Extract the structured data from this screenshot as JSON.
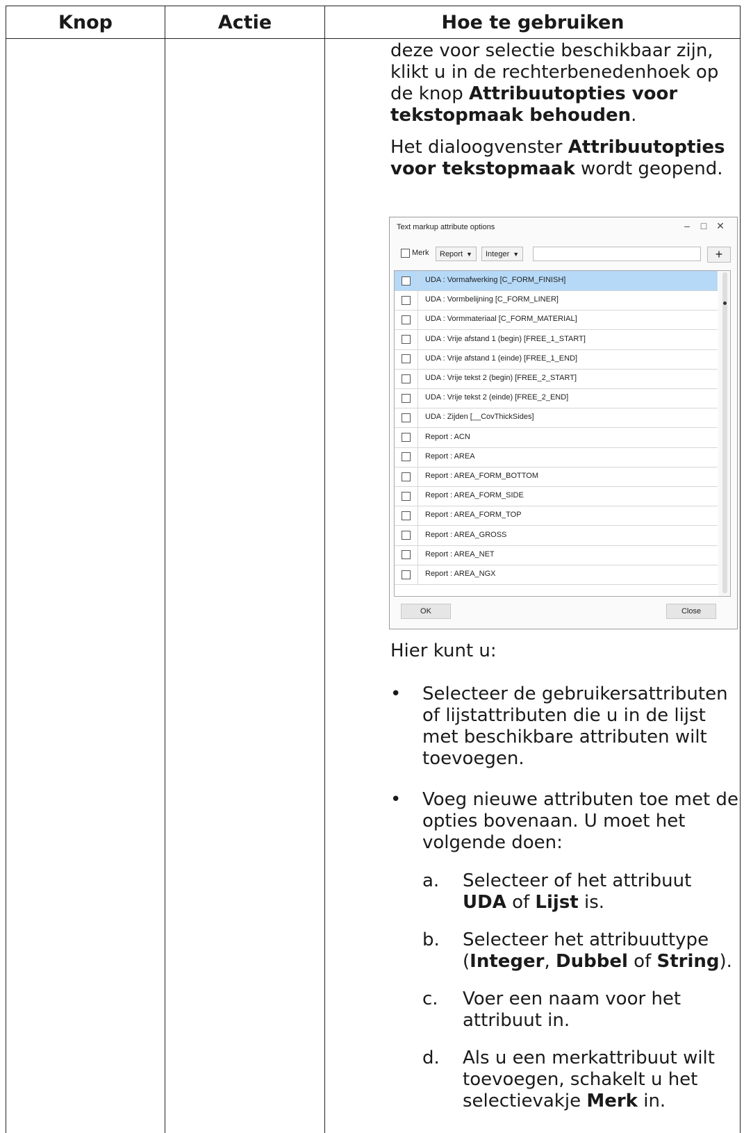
{
  "headers": [
    "Knop",
    "Actie",
    "Hoe te gebruiken"
  ],
  "intro": {
    "p1_a": "deze voor selectie beschikbaar zijn, klikt u in de rechterbenedenhoek op de knop ",
    "p1_bold": "Attribuutopties voor tekstopmaak behouden",
    "p1_end": ".",
    "p2_a": "Het dialoogvenster ",
    "p2_bold": "Attribuutopties voor tekstopmaak",
    "p2_end": " wordt geopend."
  },
  "dialog": {
    "title": "Text markup attribute options",
    "merk_label": "Merk",
    "type_dropdown": "Report",
    "value_dropdown": "Integer",
    "add_symbol": "+",
    "ok_label": "OK",
    "close_label": "Close",
    "rows": [
      "UDA : Vormafwerking [C_FORM_FINISH]",
      "UDA : Vormbelijning [C_FORM_LINER]",
      "UDA : Vormmateriaal [C_FORM_MATERIAL]",
      "UDA : Vrije afstand 1 (begin) [FREE_1_START]",
      "UDA : Vrije afstand 1 (einde) [FREE_1_END]",
      "UDA : Vrije tekst 2 (begin) [FREE_2_START]",
      "UDA : Vrije tekst 2 (einde) [FREE_2_END]",
      "UDA : Zijden [__CovThickSides]",
      "Report : ACN",
      "Report : AREA",
      "Report : AREA_FORM_BOTTOM",
      "Report : AREA_FORM_SIDE",
      "Report : AREA_FORM_TOP",
      "Report : AREA_GROSS",
      "Report : AREA_NET",
      "Report : AREA_NGX"
    ]
  },
  "lower": {
    "lead": "Hier kunt u:",
    "bullet_symbol": "•",
    "bullet1": "Selecteer de gebruikersattributen of lijstattributen die u in de lijst met beschikbare attributen wilt toevoegen.",
    "bullet2": "Voeg nieuwe attributen toe met de opties bovenaan. U moet het volgende doen:",
    "a_label": "a.",
    "a_1": "Selecteer of het attribuut ",
    "a_b1": "UDA",
    "a_2": " of ",
    "a_b2": "Lijst",
    "a_3": " is.",
    "b_label": "b.",
    "b_1": "Selecteer het attribuuttype (",
    "b_b1": "Integer",
    "b_2": ", ",
    "b_b2": "Dubbel",
    "b_3": " of ",
    "b_b3": "String",
    "b_4": ").",
    "c_label": "c.",
    "c_text": "Voer een naam voor het attribuut in.",
    "d_label": "d.",
    "d_1": "Als u een merkattribuut wilt toevoegen, schakelt u het selectievakje ",
    "d_b1": "Merk",
    "d_2": " in."
  }
}
